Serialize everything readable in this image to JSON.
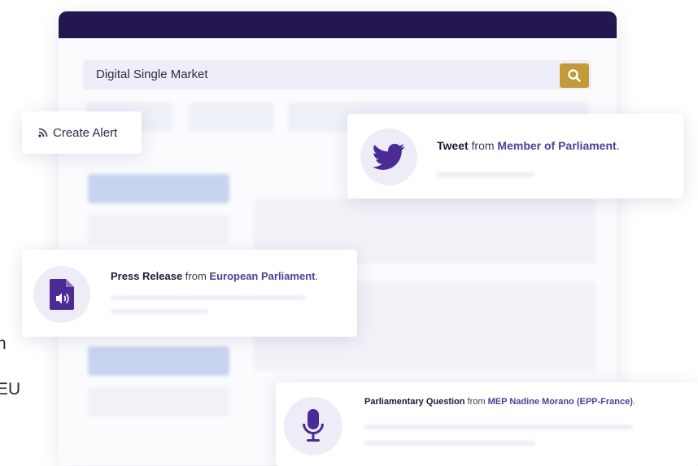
{
  "background_text": {
    "line1": "h",
    "line2": "EU"
  },
  "search": {
    "query": "Digital Single Market"
  },
  "alert": {
    "label": "Create Alert"
  },
  "tweet": {
    "type": "Tweet",
    "from_word": " from ",
    "source": "Member of Parliament",
    "end": "."
  },
  "press_release": {
    "type": "Press Release",
    "from_word": " from ",
    "source": "European Parliament",
    "end": "."
  },
  "question": {
    "type": "Parliamentary Question",
    "from_word": " from ",
    "source": "MEP Nadine Morano (EPP-France)",
    "end": "."
  },
  "colors": {
    "header": "#24174f",
    "search_button": "#c49a39",
    "accent": "#4e3f96"
  },
  "icons": [
    "search-icon",
    "rss-icon",
    "twitter-bird-icon",
    "audio-document-icon",
    "microphone-icon"
  ]
}
